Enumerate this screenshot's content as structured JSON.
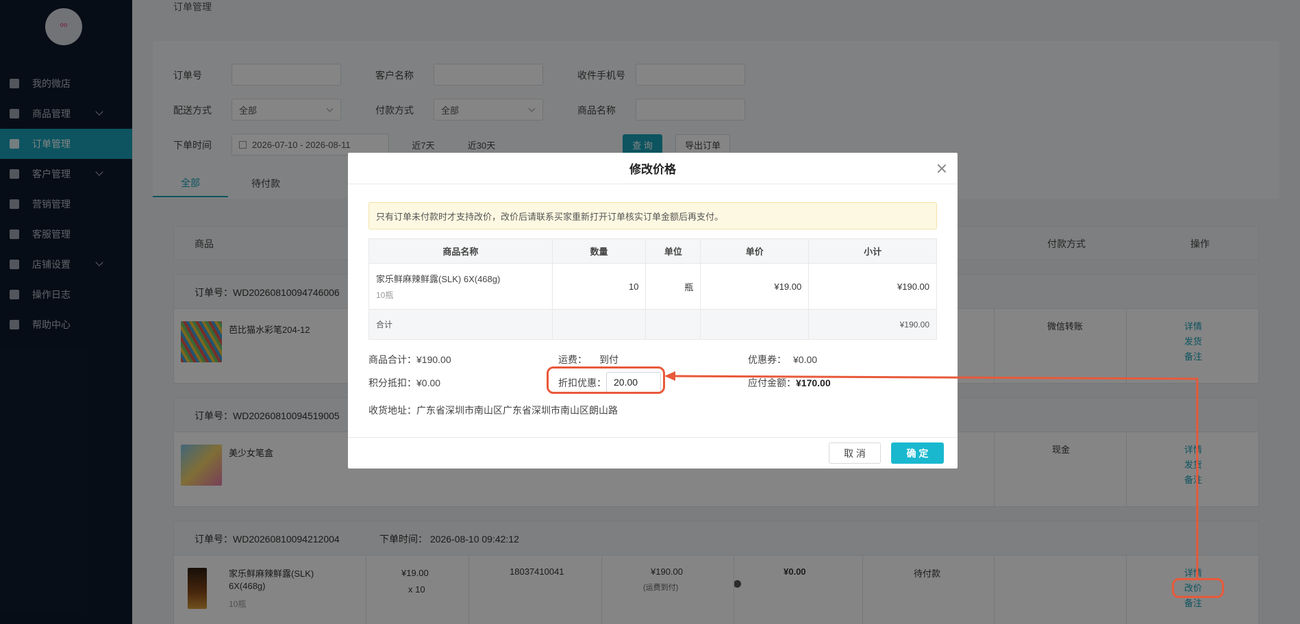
{
  "sidebar": {
    "logo_text": "oo",
    "items": [
      {
        "label": "我的微店",
        "icon": "home-icon",
        "has_sub": false,
        "active": false
      },
      {
        "label": "商品管理",
        "icon": "box-icon",
        "has_sub": true,
        "active": false
      },
      {
        "label": "订单管理",
        "icon": "list-icon",
        "has_sub": false,
        "active": true
      },
      {
        "label": "客户管理",
        "icon": "users-icon",
        "has_sub": true,
        "active": false
      },
      {
        "label": "营销管理",
        "icon": "chart-icon",
        "has_sub": false,
        "active": false
      },
      {
        "label": "客服管理",
        "icon": "chat-icon",
        "has_sub": false,
        "active": false
      },
      {
        "label": "店铺设置",
        "icon": "gear-icon",
        "has_sub": true,
        "active": false
      },
      {
        "label": "操作日志",
        "icon": "log-icon",
        "has_sub": false,
        "active": false
      },
      {
        "label": "帮助中心",
        "icon": "help-icon",
        "has_sub": false,
        "active": false
      }
    ]
  },
  "breadcrumb": "订单管理",
  "filters": {
    "order_no_label": "订单号",
    "customer_label": "客户名称",
    "phone_label": "收件手机号",
    "delivery_label": "配送方式",
    "delivery_value": "全部",
    "payment_label": "付款方式",
    "payment_value": "全部",
    "product_label": "商品名称",
    "time_label": "下单时间",
    "date_range": "2026-07-10  -  2026-08-11",
    "last7": "近7天",
    "last30": "近30天",
    "search_btn": "查 询",
    "export_btn": "导出订单"
  },
  "tabs": [
    "全部",
    "待付款"
  ],
  "table_head": {
    "product": "商品",
    "pay_method": "付款方式",
    "action": "操作"
  },
  "orders": [
    {
      "no": "订单号：WD20260810094746006",
      "product": "芭比猫水彩笔204-12",
      "pay": "微信转账",
      "links": [
        "详情",
        "发货",
        "备注"
      ]
    },
    {
      "no": "订单号：WD20260810094519005",
      "product": "美少女笔盒",
      "pay": "现金",
      "links": [
        "详情",
        "发货",
        "备注"
      ]
    },
    {
      "no": "订单号：WD20260810094212004",
      "time": "下单时间：  2026-08-10 09:42:12",
      "product": "家乐鲜麻辣鲜露(SLK) 6X(468g)",
      "spec": "10瓶",
      "price": "¥19.00",
      "qty": "x 10",
      "phone": "18037410041",
      "amount": "¥190.00",
      "freight_note": "(运费到付)",
      "paid": "¥0.00",
      "status": "待付款",
      "links": [
        "详情",
        "改价",
        "备注"
      ]
    }
  ],
  "modal": {
    "title": "修改价格",
    "notice": "只有订单未付款时才支持改价，改价后请联系买家重新打开订单核实订单金额后再支付。",
    "headers": [
      "商品名称",
      "数量",
      "单位",
      "单价",
      "小计"
    ],
    "item": {
      "name": "家乐鲜麻辣鲜露(SLK) 6X(468g)",
      "spec": "10瓶",
      "qty": "10",
      "unit": "瓶",
      "price": "¥19.00",
      "subtotal": "¥190.00"
    },
    "total_label": "合计",
    "total_value": "¥190.00",
    "goods_total_label": "商品合计：",
    "goods_total": "¥190.00",
    "freight_label": "运费：",
    "freight": "到付",
    "coupon_label": "优惠券：",
    "coupon": "¥0.00",
    "points_label": "积分抵扣：",
    "points": "¥0.00",
    "discount_label": "折扣优惠：",
    "discount_value": "20.00",
    "payable_label": "应付金额：",
    "payable": "¥170.00",
    "address_label": "收货地址：",
    "address": "广东省深圳市南山区广东省深圳市南山区朗山路",
    "cancel": "取 消",
    "ok": "确 定"
  },
  "colors": {
    "accent": "#1aa2b8",
    "annotation": "#e8593a",
    "sidebar": "#0f1a2c"
  }
}
